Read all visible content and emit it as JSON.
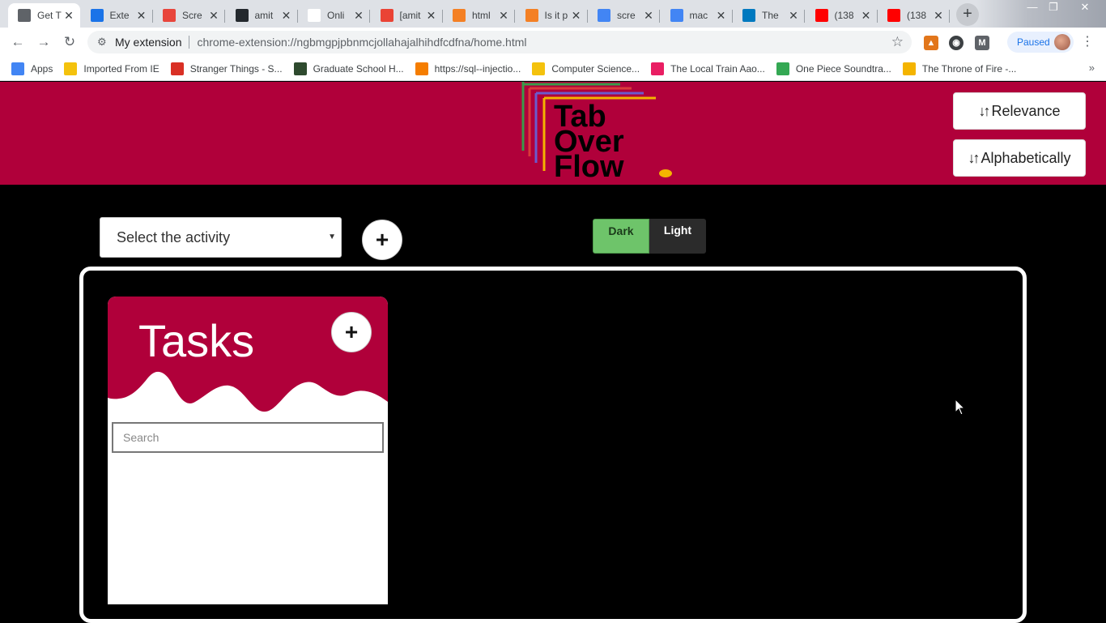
{
  "browser": {
    "tabs": [
      {
        "title": "Get T",
        "icon": "medium-m-icon",
        "color": "#5f6368",
        "active": true
      },
      {
        "title": "Exte",
        "icon": "puzzle-icon",
        "color": "#1a73e8",
        "active": false
      },
      {
        "title": "Scre",
        "icon": "chrome-icon",
        "color": "#e8453c",
        "active": false
      },
      {
        "title": "amit",
        "icon": "github-icon",
        "color": "#24292e",
        "active": false
      },
      {
        "title": "Onli",
        "icon": "document-icon",
        "color": "#ffffff",
        "active": false
      },
      {
        "title": "[amit",
        "icon": "gmail-icon",
        "color": "#ea4335",
        "active": false
      },
      {
        "title": "html",
        "icon": "stackoverflow-icon",
        "color": "#f48024",
        "active": false
      },
      {
        "title": "Is it p",
        "icon": "stackoverflow-icon",
        "color": "#f48024",
        "active": false
      },
      {
        "title": "scre",
        "icon": "google-icon",
        "color": "#4285f4",
        "active": false
      },
      {
        "title": "mac",
        "icon": "google-icon",
        "color": "#4285f4",
        "active": false
      },
      {
        "title": "The",
        "icon": "trello-icon",
        "color": "#0079bf",
        "active": false
      },
      {
        "title": "(138",
        "icon": "youtube-icon",
        "color": "#ff0000",
        "active": false
      },
      {
        "title": "(138",
        "icon": "youtube-icon",
        "color": "#ff0000",
        "active": false
      }
    ],
    "omnibox": {
      "site_label": "My extension",
      "url": "chrome-extension://ngbmgpjpbnmcjollahajalhihdfcdfna/home.html"
    },
    "profile_status": "Paused",
    "bookmarks": [
      {
        "label": "Apps",
        "icon": "apps-grid-icon",
        "color": "#4285f4"
      },
      {
        "label": "Imported From IE",
        "icon": "folder-icon",
        "color": "#f4c20d"
      },
      {
        "label": "Stranger Things - S...",
        "icon": "stranger-things-icon",
        "color": "#d93025"
      },
      {
        "label": "Graduate School H...",
        "icon": "ist-icon",
        "color": "#2e4a2e"
      },
      {
        "label": "https://sql--injectio...",
        "icon": "blogger-icon",
        "color": "#f57d00"
      },
      {
        "label": "Computer Science...",
        "icon": "folder-image-icon",
        "color": "#f4c20d"
      },
      {
        "label": "The Local Train Aao...",
        "icon": "music-icon",
        "color": "#e91e63"
      },
      {
        "label": "One Piece Soundtra...",
        "icon": "play-store-icon",
        "color": "#34a853"
      },
      {
        "label": "The Throne of Fire -...",
        "icon": "diamond-icon",
        "color": "#f4b400"
      }
    ]
  },
  "header": {
    "logo_lines": [
      "Tab",
      "Over",
      "Flow"
    ],
    "sort_relevance": "Relevance",
    "sort_alphabetically": "Alphabetically",
    "colors": {
      "brand": "#b0003a",
      "logo_dot": "#f4b400"
    }
  },
  "controls": {
    "activity_select": "Select the activity",
    "theme_dark": "Dark",
    "theme_light": "Light",
    "add_symbol": "+"
  },
  "task_card": {
    "title": "Tasks",
    "add_symbol": "+",
    "search_placeholder": "Search"
  }
}
